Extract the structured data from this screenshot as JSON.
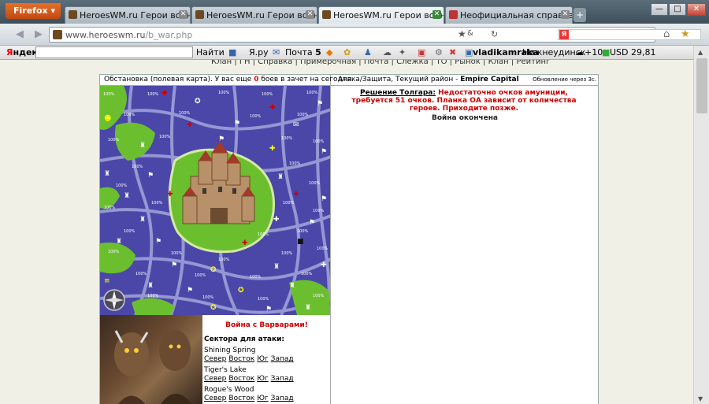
{
  "browser": {
    "menu_label": "Firefox",
    "tabs": [
      {
        "label": "HeroesWM.ru Герои войны ...",
        "active": false
      },
      {
        "label": "HeroesWM.ru Герои войны ...",
        "active": false
      },
      {
        "label": "HeroesWM.ru Герои войны ...",
        "active": true
      },
      {
        "label": "Неофициальная справка п...",
        "active": false
      }
    ],
    "new_tab": "+",
    "url_domain": "www.heroeswm.ru",
    "url_path": "/b_war.php",
    "window_controls": [
      "—",
      "□",
      "✕"
    ]
  },
  "yandex_bar": {
    "logo_red": "Я",
    "logo_rest": "ндекс",
    "find_label": "Найти",
    "yaru_label": "Я.ру",
    "mail_label": "Почта",
    "mail_count": "5",
    "user_label": "vladikamraka",
    "city_label": "Нижнеудинск",
    "temp_label": "+10",
    "usd_label": "USD 29,81"
  },
  "site_menu": "Клан | ГН | Справка | Примерочная | Почта | Слежка | ТО | Рынок | Клан | Рейтинг",
  "map_header": {
    "text_before": "Обстановка (полевая карта). У вас еще ",
    "count": "0",
    "text_after": " боев в зачет на сегодня."
  },
  "right_header": {
    "text": "Атака/Защита, Текущий район - ",
    "district": "Empire Capital",
    "update": "Обновление через 3с."
  },
  "decision": {
    "label": "Решение Толгара:",
    "text": " Недостаточно очков амуниции, требуется 51 очков. Планка ОА зависит от количества героев. Приходите позже."
  },
  "war_over": "Война окончена",
  "war_title": "Война с Варварами!",
  "sectors_title": "Сектора для атаки:",
  "sectors": [
    {
      "name": "Shining Spring",
      "dirs": [
        "Север",
        "Восток",
        "Юг",
        "Запад"
      ]
    },
    {
      "name": "Tiger's Lake",
      "dirs": [
        "Север",
        "Восток",
        "Юг",
        "Запад"
      ]
    },
    {
      "name": "Rogue's Wood",
      "dirs": [
        "Север",
        "Восток",
        "Юг",
        "Запад"
      ]
    }
  ],
  "map_percent": "100%",
  "colors": {
    "map_bg": "#4a47a8",
    "grass": "#6bbf2e",
    "road": "#9ea0d8",
    "alert": "#cc0000"
  }
}
